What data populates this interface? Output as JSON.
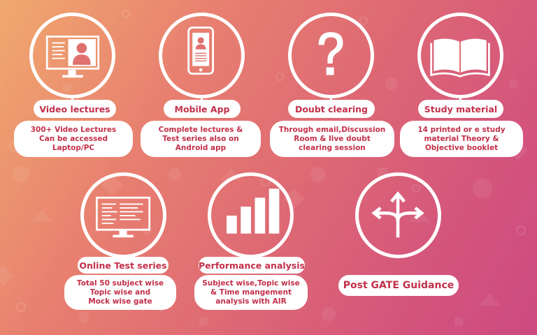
{
  "theme": {
    "accent": "#c2304a",
    "pill_bg": "#ffffff",
    "bg_start": "#f0a96e",
    "bg_end": "#cc4a80"
  },
  "features": [
    {
      "id": "video-lectures",
      "icon": "monitor-person-icon",
      "title": "Video lectures",
      "description": "300+  Video Lectures\nCan be accessed\nLaptop/PC"
    },
    {
      "id": "mobile-app",
      "icon": "mobile-phone-icon",
      "title": "Mobile App",
      "description": "Complete lectures &\nTest series also on\nAndroid app"
    },
    {
      "id": "doubt-clearing",
      "icon": "question-mark-icon",
      "title": "Doubt clearing",
      "description": "Through email,Discussion\nRoom  & live doubt\nclearing session"
    },
    {
      "id": "study-material",
      "icon": "open-book-icon",
      "title": "Study material",
      "description": "14 printed or e study\nmaterial Theory &\nObjective booklet"
    },
    {
      "id": "online-test-series",
      "icon": "monitor-code-icon",
      "title": "Online Test series",
      "description": "Total 50 subject wise\nTopic wise and\nMock wise gate"
    },
    {
      "id": "performance-analysis",
      "icon": "bar-chart-icon",
      "title": "Performance analysis",
      "description": "Subject wise,Topic wise\n& Time mangement\nanalysis with AIR"
    },
    {
      "id": "post-gate-guidance",
      "icon": "diverging-arrows-icon",
      "title": "Post GATE Guidance"
    }
  ]
}
